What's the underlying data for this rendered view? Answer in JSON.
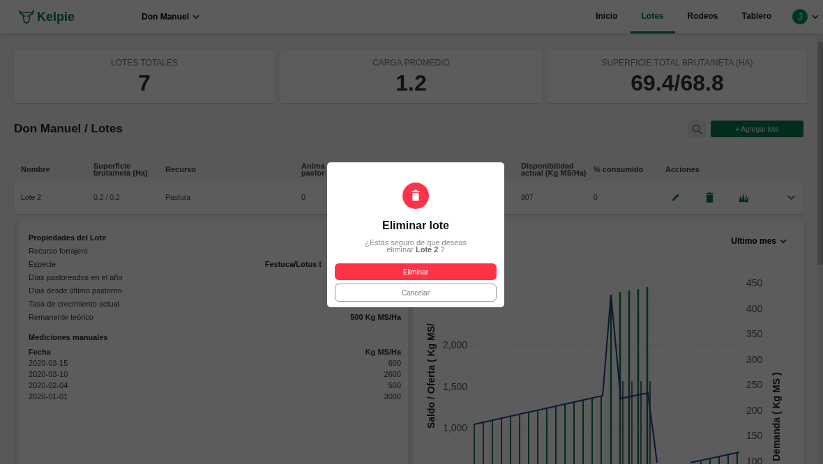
{
  "navbar": {
    "logo": "Kelpie",
    "farm": "Don Manuel",
    "tabs": [
      {
        "label": "Inicio",
        "selected": false
      },
      {
        "label": "Lotes",
        "selected": true
      },
      {
        "label": "Rodeos",
        "selected": false
      },
      {
        "label": "Tablero",
        "selected": false
      }
    ],
    "avatar": "J"
  },
  "stats": [
    {
      "label": "LOTES TOTALES",
      "value": "7"
    },
    {
      "label": "CARGA PROMEDIO",
      "value": "1.2"
    },
    {
      "label": "SUPERFICIE TOTAL BRUTA/NETA (HA)",
      "value": "69.4/68.8"
    }
  ],
  "page_title": "Don Manuel / Lotes",
  "add_button": "+ Agregar lote",
  "table": {
    "columns": [
      "Nombre",
      "Superficie\nbruta/neta (Ha)",
      "Recurso",
      "Anima\npastor",
      "Disponibilidad\nactual (Kg MS/Ha)",
      "% consumido",
      "Acciones"
    ],
    "rows": [
      {
        "cells": [
          "Lote 2",
          "0.2 / 0.2",
          "Pastura",
          "0",
          "807",
          "0"
        ]
      }
    ]
  },
  "details": {
    "title": "Propiedades del Lote",
    "properties": [
      {
        "label": "Recurso forrajero",
        "kind": "full"
      },
      {
        "label": "Especie",
        "value": "Festuca/Lotus t",
        "kind": "partial"
      },
      {
        "label": "Días pastoreados en el año",
        "kind": "full"
      },
      {
        "label": "Días desde último pastoreo",
        "kind": "full"
      },
      {
        "label": "Tasa de crecimiento actual",
        "kind": "full"
      },
      {
        "label": "Remanente teórico",
        "value": "500 Kg MS/Ha",
        "kind": "full"
      }
    ],
    "measurements_title": "Mediciones manuales",
    "measurement_columns": [
      "Fecha",
      "Kg MS/Ha"
    ],
    "measurements": [
      [
        "2020-03-15",
        "600"
      ],
      [
        "2020-03-10",
        "2600"
      ],
      [
        "2020-02-04",
        "500"
      ],
      [
        "2020-01-01",
        "3000"
      ]
    ]
  },
  "chart": {
    "period": "Ultimo mes",
    "ylabel_left": "Saldo / Oferta ( Kg MS/",
    "ylabel_right": "Demanda ( Kg MS )",
    "left_ticks": [
      "2,000",
      "1,500",
      "1,000"
    ],
    "right_ticks": [
      "450",
      "400",
      "350",
      "300",
      "250",
      "200",
      "150",
      "100"
    ]
  },
  "dialog": {
    "title": "Eliminar lote",
    "message": "¿Estás seguro de que deseas eliminar **Lote 2** ?",
    "confirm": "Eliminar",
    "cancel": "Cancelar"
  }
}
